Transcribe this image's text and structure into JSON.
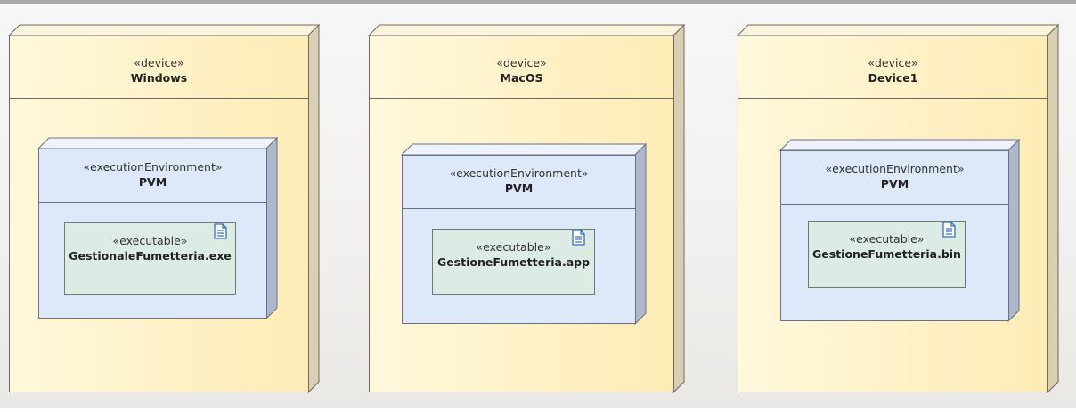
{
  "diagram": {
    "nodes": [
      {
        "stereotype": "«device»",
        "name": "Windows",
        "environment": {
          "stereotype": "«executionEnvironment»",
          "name": "PVM",
          "artifact": {
            "stereotype": "«executable»",
            "name": "GestionaleFumetteria.exe",
            "icon": "document-icon"
          }
        }
      },
      {
        "stereotype": "«device»",
        "name": "MacOS",
        "environment": {
          "stereotype": "«executionEnvironment»",
          "name": "PVM",
          "artifact": {
            "stereotype": "«executable»",
            "name": "GestioneFumetteria.app",
            "icon": "document-icon"
          }
        }
      },
      {
        "stereotype": "«device»",
        "name": "Device1",
        "environment": {
          "stereotype": "«executionEnvironment»",
          "name": "PVM",
          "artifact": {
            "stereotype": "«executable»",
            "name": "GestioneFumetteria.bin",
            "icon": "document-icon"
          }
        }
      }
    ],
    "colors": {
      "device_fill": "#fdecb5",
      "environment_fill": "#dde8f8",
      "artifact_fill": "#dcece4",
      "outline": "#6e6a5e"
    }
  }
}
